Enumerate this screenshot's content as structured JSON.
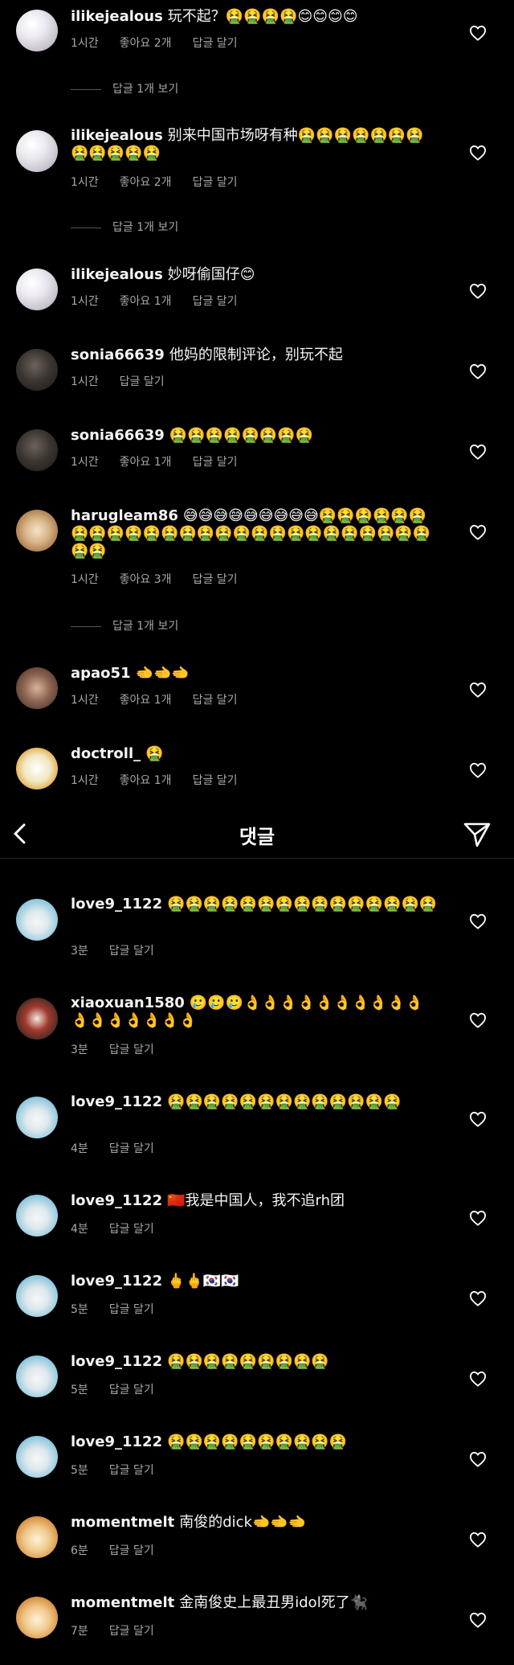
{
  "header": {
    "title": "댓글"
  },
  "top_comments": [
    {
      "user": "ilikejealous",
      "text": "玩不起？🤮🤮🤮🤮😊😊😊😊",
      "time": "1시간",
      "likes": "좋아요 2개",
      "reply": "답글 달기",
      "view_replies": "답글 1개 보기",
      "avatar": "pearl"
    },
    {
      "user": "ilikejealous",
      "text": "别来中国市场呀有种🤮🤮🤮🤮🤮🤮🤮🤮🤮🤮🤮🤮",
      "time": "1시간",
      "likes": "좋아요 2개",
      "reply": "답글 달기",
      "view_replies": "답글 1개 보기",
      "avatar": "pearl"
    },
    {
      "user": "ilikejealous",
      "text": "妙呀偷国仔😊",
      "time": "1시간",
      "likes": "좋아요 1개",
      "reply": "답글 달기",
      "view_replies": "",
      "avatar": "pearl"
    },
    {
      "user": "sonia66639",
      "text": "他妈的限制评论，别玩不起",
      "time": "1시간",
      "likes": "",
      "reply": "답글 달기",
      "view_replies": "",
      "avatar": "dark"
    },
    {
      "user": "sonia66639",
      "text": "🤮🤮🤮🤮🤮🤮🤮🤮",
      "time": "1시간",
      "likes": "좋아요 1개",
      "reply": "답글 달기",
      "view_replies": "",
      "avatar": "dark"
    },
    {
      "user": "harugleam86",
      "text": "😅😅😅😅😅😅😅😅😅🤮🤮🤮🤮🤮🤮🤮🤮🤮🤮🤮🤮🤮🤮🤮🤮🤮🤮🤮🤮🤮🤮🤮🤮🤮🤮🤮🤮",
      "time": "1시간",
      "likes": "좋아요 3개",
      "reply": "답글 달기",
      "view_replies": "답글 1개 보기",
      "avatar": "dog"
    },
    {
      "user": "apao51",
      "text": "🫲🫲🫲",
      "time": "1시간",
      "likes": "좋아요 1개",
      "reply": "답글 달기",
      "view_replies": "",
      "avatar": "photo"
    },
    {
      "user": "doctroll_",
      "text": "🤮",
      "time": "1시간",
      "likes": "좋아요 1개",
      "reply": "답글 달기",
      "view_replies": "",
      "avatar": "cartoon"
    }
  ],
  "bottom_comments": [
    {
      "user": "love9_1122",
      "text": "🤮🤮🤮🤮🤮🤮🤮🤮🤮🤮🤮🤮🤮🤮🤮",
      "time": "3분",
      "reply": "답글 달기",
      "avatar": "pup"
    },
    {
      "user": "xiaoxuan1580",
      "text": "🥲🥲🥲👌👌👌👌👌👌👌👌👌👌👌👌👌👌👌👌👌",
      "time": "3분",
      "reply": "답글 달기",
      "avatar": "poster"
    },
    {
      "user": "love9_1122",
      "text": "🤮🤮🤮🤮🤮🤮🤮🤮🤮🤮🤮🤮🤮",
      "time": "4분",
      "reply": "답글 달기",
      "avatar": "pup"
    },
    {
      "user": "love9_1122",
      "text": "🇨🇳我是中国人，我不追rh团",
      "time": "4분",
      "reply": "답글 달기",
      "avatar": "pup"
    },
    {
      "user": "love9_1122",
      "text": "🖕🖕🇰🇷🇰🇷",
      "time": "5분",
      "reply": "답글 달기",
      "avatar": "pup"
    },
    {
      "user": "love9_1122",
      "text": "🤮🤮🤮🤮🤮🤮🤮🤮🤮",
      "time": "5분",
      "reply": "답글 달기",
      "avatar": "pup"
    },
    {
      "user": "love9_1122",
      "text": "🤮🤮🤮🤮🤮🤮🤮🤮🤮🤮",
      "time": "5분",
      "reply": "답글 달기",
      "avatar": "pup"
    },
    {
      "user": "momentmelt",
      "text": "南俊的dick🫲🫲🫲",
      "time": "6분",
      "reply": "답글 달기",
      "avatar": "cat"
    },
    {
      "user": "momentmelt",
      "text": "金南俊史上最丑男idol死了🐈‍⬛",
      "time": "7분",
      "reply": "답글 달기",
      "avatar": "cat"
    }
  ]
}
